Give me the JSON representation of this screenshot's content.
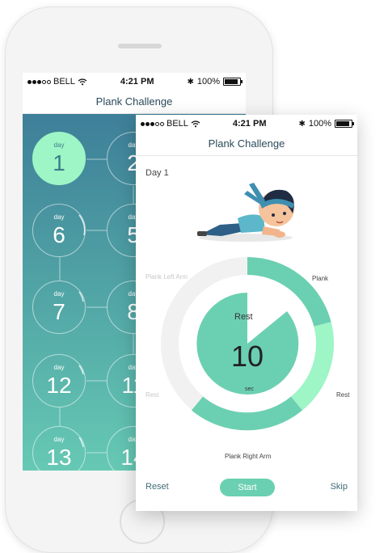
{
  "back_screen": {
    "status": {
      "carrier": "BELL",
      "time": "4:21 PM",
      "battery": "100%"
    },
    "title": "Plank Challenge",
    "days": [
      {
        "label": "day",
        "num": "1"
      },
      {
        "label": "day",
        "num": "2"
      },
      {
        "label": "day",
        "num": "6"
      },
      {
        "label": "day",
        "num": "5"
      },
      {
        "label": "day",
        "num": "7"
      },
      {
        "label": "day",
        "num": "8"
      },
      {
        "label": "day",
        "num": "12"
      },
      {
        "label": "day",
        "num": "11"
      },
      {
        "label": "day",
        "num": "13"
      },
      {
        "label": "day",
        "num": "14"
      }
    ]
  },
  "front_screen": {
    "status": {
      "carrier": "BELL",
      "time": "4:21 PM",
      "battery": "100%"
    },
    "title": "Plank Challenge",
    "day_text": "Day 1",
    "segments": {
      "plank_left_arm": "Plank Left Arm",
      "plank": "Plank",
      "rest_right": "Rest",
      "plank_right_arm": "Plank Right Arm",
      "rest_left": "Rest"
    },
    "center": {
      "title": "Rest",
      "value": "10",
      "unit": "sec"
    },
    "buttons": {
      "reset": "Reset",
      "start": "Start",
      "skip": "Skip"
    }
  },
  "colors": {
    "accent": "#6bd0b1",
    "accent_light": "#9ef5c6",
    "ring_bg": "#efefef",
    "grid_top": "#3e7f99",
    "grid_bottom": "#66c9b4"
  }
}
